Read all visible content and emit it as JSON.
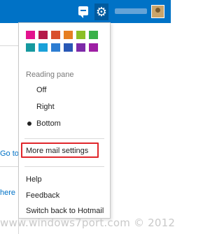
{
  "topbar": {
    "accent": "#0072c6",
    "icons": [
      "chat-icon",
      "gear-icon",
      "avatar"
    ]
  },
  "left_panel": {
    "link_top": "Go to",
    "link_bottom": "here"
  },
  "settings_menu": {
    "theme_colors": [
      "#e3128e",
      "#b51a4a",
      "#d9502e",
      "#e67e22",
      "#8bbf26",
      "#3bb14a",
      "#16999f",
      "#1aa1d9",
      "#2d7dd2",
      "#2958b5",
      "#7d2aa8",
      "#9e1fa4"
    ],
    "reading_pane_heading": "Reading pane",
    "reading_pane_options": [
      {
        "label": "Off",
        "selected": false
      },
      {
        "label": "Right",
        "selected": false
      },
      {
        "label": "Bottom",
        "selected": true
      }
    ],
    "more_settings_label": "More mail settings",
    "help_label": "Help",
    "feedback_label": "Feedback",
    "switch_label": "Switch back to Hotmail"
  },
  "watermark": "www.windows7port.com © 2012"
}
